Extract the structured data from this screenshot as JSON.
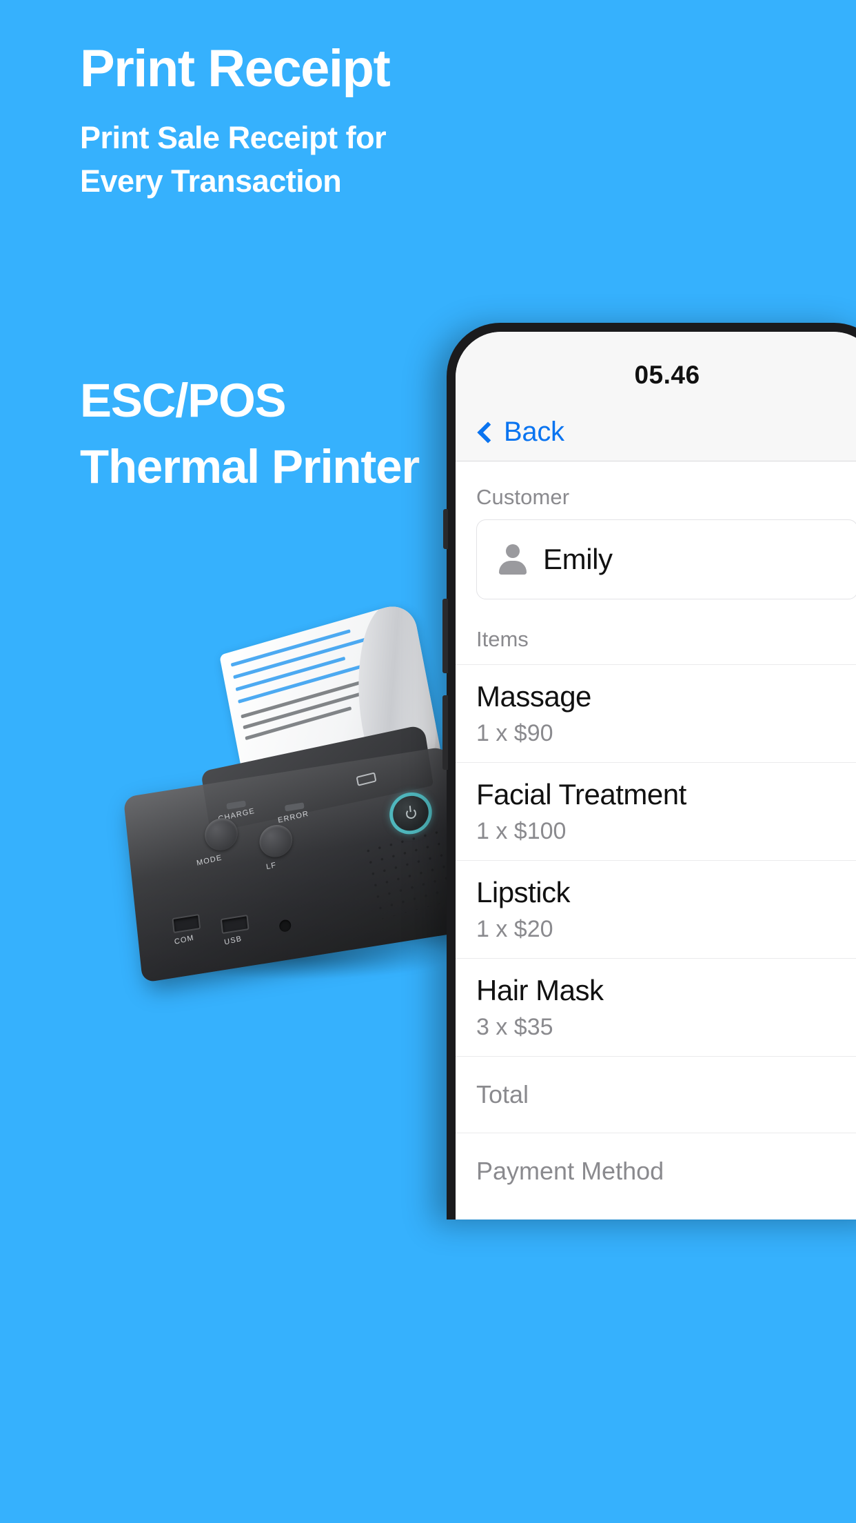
{
  "promo": {
    "title": "Print Receipt",
    "subtitle": "Print Sale Receipt for Every Transaction",
    "second_title": "ESC/POS Thermal Printer"
  },
  "phone": {
    "status_time": "05.46",
    "nav": {
      "back_label": "Back"
    },
    "screen": {
      "customer_section_label": "Customer",
      "customer_name": "Emily",
      "items_section_label": "Items",
      "items": [
        {
          "name": "Massage",
          "qty_price": "1 x $90"
        },
        {
          "name": "Facial Treatment",
          "qty_price": "1 x $100"
        },
        {
          "name": "Lipstick",
          "qty_price": "1 x $20"
        },
        {
          "name": "Hair Mask",
          "qty_price": "3 x $35"
        }
      ],
      "total_label": "Total",
      "payment_method_label": "Payment Method"
    }
  },
  "printer": {
    "labels": {
      "charge": "CHARGE",
      "error": "ERROR",
      "mode": "MODE",
      "lf": "LF",
      "com": "COM",
      "usb": "USB"
    }
  },
  "colors": {
    "background": "#36b1fd",
    "accent_blue": "#0a74f0",
    "text_primary": "#111111",
    "text_muted": "#8a8a8e"
  }
}
